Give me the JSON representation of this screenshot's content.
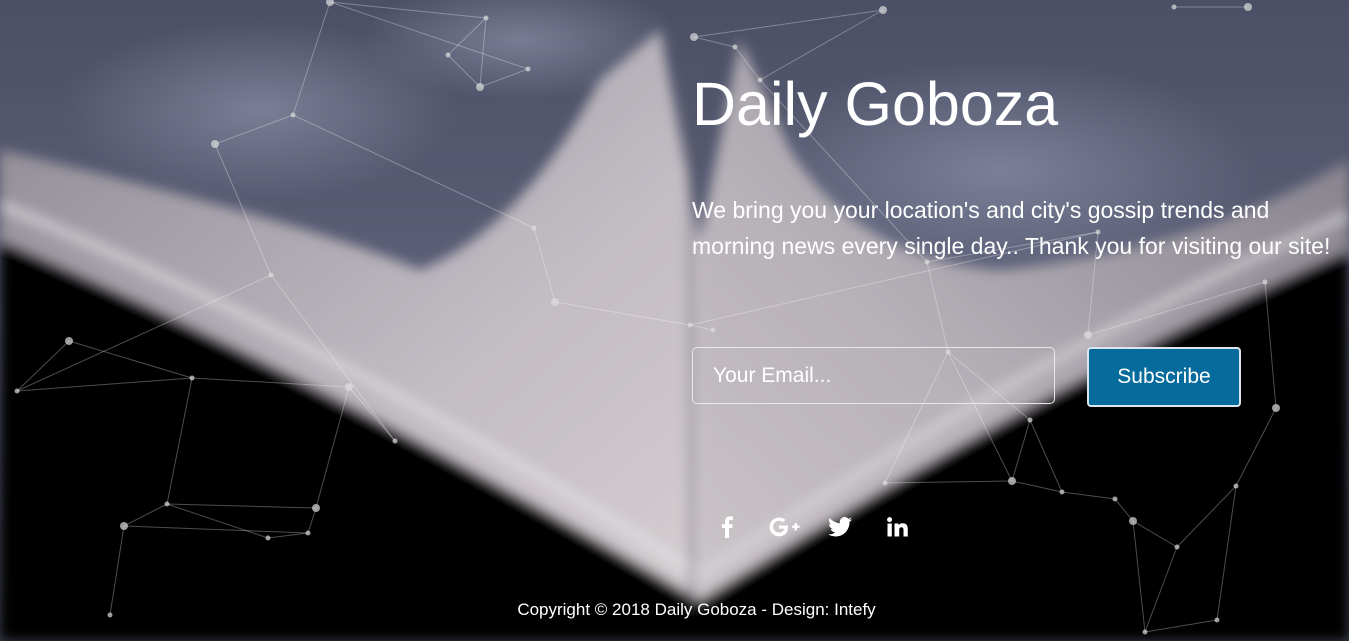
{
  "site": {
    "title": "Daily Goboza",
    "tagline": "We bring you your location's and city's gossip trends and morning news every single day.. Thank you for visiting our site!"
  },
  "subscribe_form": {
    "email_placeholder": "Your Email...",
    "email_value": "",
    "button_label": "Subscribe"
  },
  "social_links": [
    {
      "network": "Facebook",
      "icon": "facebook-icon"
    },
    {
      "network": "Google Plus",
      "icon": "google-plus-icon"
    },
    {
      "network": "Twitter",
      "icon": "twitter-icon"
    },
    {
      "network": "LinkedIn",
      "icon": "linkedin-icon"
    }
  ],
  "footer": {
    "copyright": "Copyright © 2018 Daily Goboza - Design: Intefy"
  },
  "colors": {
    "subscribe_button": "#056b9c",
    "text": "#ffffff",
    "sky": "#4a4f66",
    "roof": "#b7b2bb",
    "ground": "#050505"
  }
}
